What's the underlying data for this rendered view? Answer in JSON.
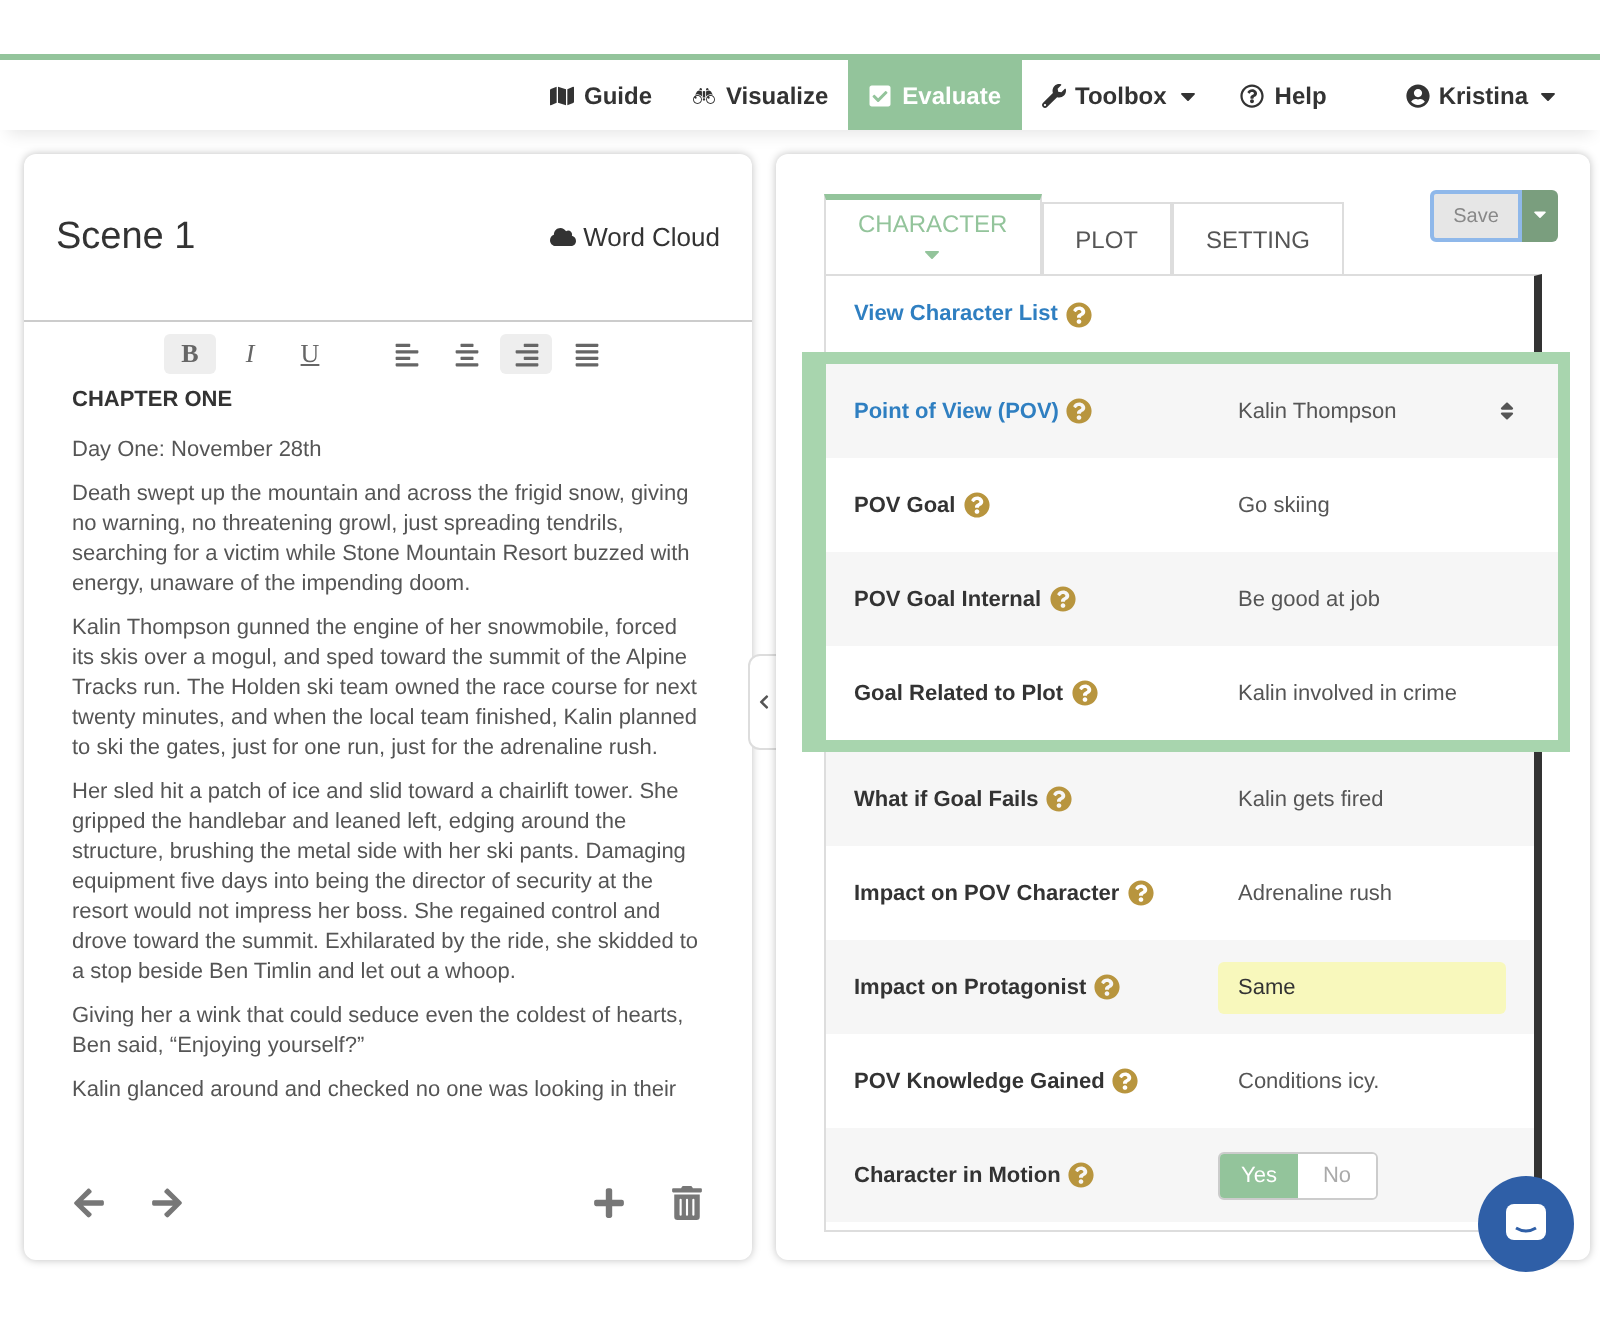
{
  "nav": [
    {
      "label": "Guide",
      "selected": false
    },
    {
      "label": "Visualize",
      "selected": false
    },
    {
      "label": "Evaluate",
      "selected": true
    },
    {
      "label": "Toolbox",
      "selected": false
    },
    {
      "label": "Help",
      "selected": false
    }
  ],
  "user": {
    "name": "Kristina"
  },
  "scene": {
    "title": "Scene 1",
    "word_cloud": "Word Cloud",
    "toolbar": [
      {
        "label": "B",
        "kind": "bold",
        "selected": true
      },
      {
        "label": "I",
        "kind": "italic",
        "selected": false
      },
      {
        "label": "U",
        "kind": "underline",
        "selected": false
      },
      {
        "kind": "align-left",
        "selected": false
      },
      {
        "kind": "align-center",
        "selected": false
      },
      {
        "kind": "align-right",
        "selected": true
      },
      {
        "kind": "justify",
        "selected": false
      }
    ],
    "paragraphs": [
      {
        "kind": "heading",
        "text": "CHAPTER ONE"
      },
      {
        "kind": "body",
        "text": "Day One: November 28th"
      },
      {
        "kind": "body",
        "text": "Death swept up the mountain and across the frigid snow, giving no warning, no threatening growl, just spreading tendrils, searching for a victim while Stone Mountain Resort buzzed with energy, unaware of the impending doom."
      },
      {
        "kind": "body",
        "text": "Kalin Thompson gunned the engine of her snowmobile, forced its skis over a mogul, and sped toward the summit of the Alpine Tracks run. The Holden ski team owned the race course for next twenty minutes, and when the local team finished, Kalin planned to ski the gates, just for one run, just for the adrenaline rush."
      },
      {
        "kind": "body",
        "text": "Her sled hit a patch of ice and slid toward a chairlift tower. She gripped the handlebar and leaned left, edging around the structure, brushing the metal side with her ski pants. Damaging equipment five days into being the director of security at the resort would not impress her boss. She regained control and drove toward the summit. Exhilarated by the ride, she skidded to a stop beside Ben Timlin and let out a whoop."
      },
      {
        "kind": "body",
        "text": "Giving her a wink that could seduce even the coldest of hearts, Ben said, “Enjoying yourself?”"
      },
      {
        "kind": "body",
        "text": "Kalin glanced around and checked no one was looking in their"
      }
    ]
  },
  "tabs": [
    {
      "label": "CHARACTER",
      "selected": true
    },
    {
      "label": "PLOT",
      "selected": false
    },
    {
      "label": "SETTING",
      "selected": false
    }
  ],
  "save": {
    "label": "Save",
    "disabled": true
  },
  "link": "View Character List",
  "fields": [
    {
      "label": "Point of View (POV)",
      "kind": "select",
      "value": "Kalin Thompson",
      "highlighted": true
    },
    {
      "label": "POV Goal",
      "kind": "text",
      "value": "Go skiing",
      "highlighted": true
    },
    {
      "label": "POV Goal Internal",
      "kind": "text",
      "value": "Be good at job",
      "highlighted": true
    },
    {
      "label": "Goal Related to Plot",
      "kind": "text",
      "value": "Kalin involved in crime",
      "highlighted": true
    },
    {
      "label": "What if Goal Fails",
      "kind": "text",
      "value": "Kalin gets fired",
      "highlighted": false
    },
    {
      "label": "Impact on POV Character",
      "kind": "text",
      "value": "Adrenaline rush",
      "highlighted": false
    },
    {
      "label": "Impact on Protagonist",
      "kind": "input",
      "value": "Same",
      "highlighted": false
    },
    {
      "label": "POV Knowledge Gained",
      "kind": "text",
      "value": "Conditions icy.",
      "highlighted": false
    },
    {
      "label": "Character in Motion",
      "kind": "toggle",
      "options": [
        {
          "label": "Yes",
          "selected": true
        },
        {
          "label": "No",
          "selected": false
        }
      ],
      "highlighted": false
    }
  ]
}
